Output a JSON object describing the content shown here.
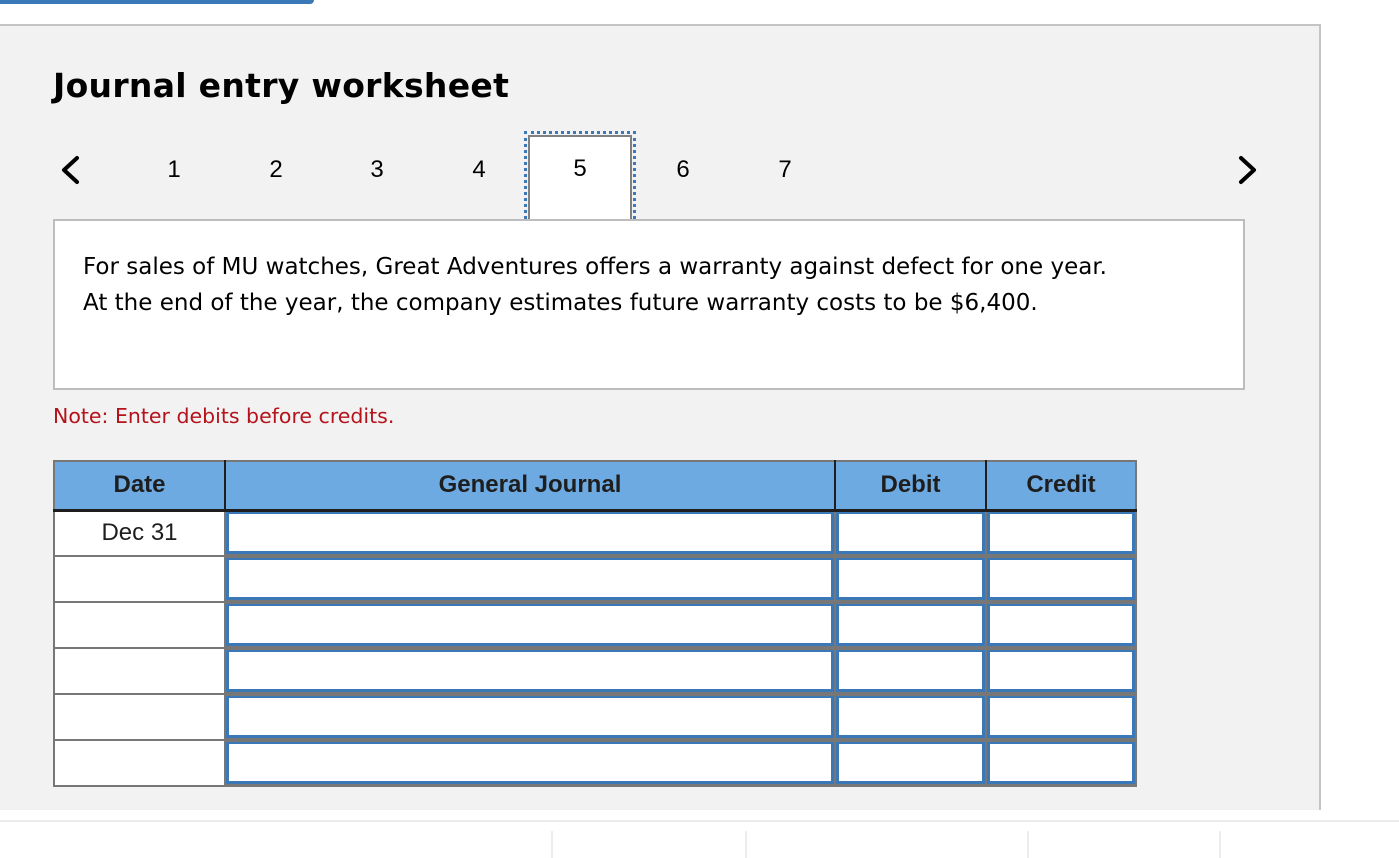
{
  "worksheet": {
    "title": "Journal entry worksheet",
    "nav": {
      "prev_icon": "chevron-left-icon",
      "next_icon": "chevron-right-icon",
      "steps": [
        "1",
        "2",
        "3",
        "4",
        "5",
        "6",
        "7"
      ],
      "active_step": "5"
    },
    "question_text": "For sales of MU watches, Great Adventures offers a warranty against defect for one year. At the end of the year, the company estimates future warranty costs to be $6,400.",
    "note": "Note: Enter debits before credits.",
    "table": {
      "headers": [
        "Date",
        "General Journal",
        "Debit",
        "Credit"
      ],
      "rows": [
        {
          "date": "Dec 31",
          "account": "",
          "debit": "",
          "credit": ""
        },
        {
          "date": "",
          "account": "",
          "debit": "",
          "credit": ""
        },
        {
          "date": "",
          "account": "",
          "debit": "",
          "credit": ""
        },
        {
          "date": "",
          "account": "",
          "debit": "",
          "credit": ""
        },
        {
          "date": "",
          "account": "",
          "debit": "",
          "credit": ""
        },
        {
          "date": "",
          "account": "",
          "debit": "",
          "credit": ""
        }
      ]
    }
  },
  "colors": {
    "accent": "#3a78b8",
    "header_bg": "#6eaae2",
    "note_red": "#b5121b",
    "panel_bg": "#f2f2f2"
  }
}
